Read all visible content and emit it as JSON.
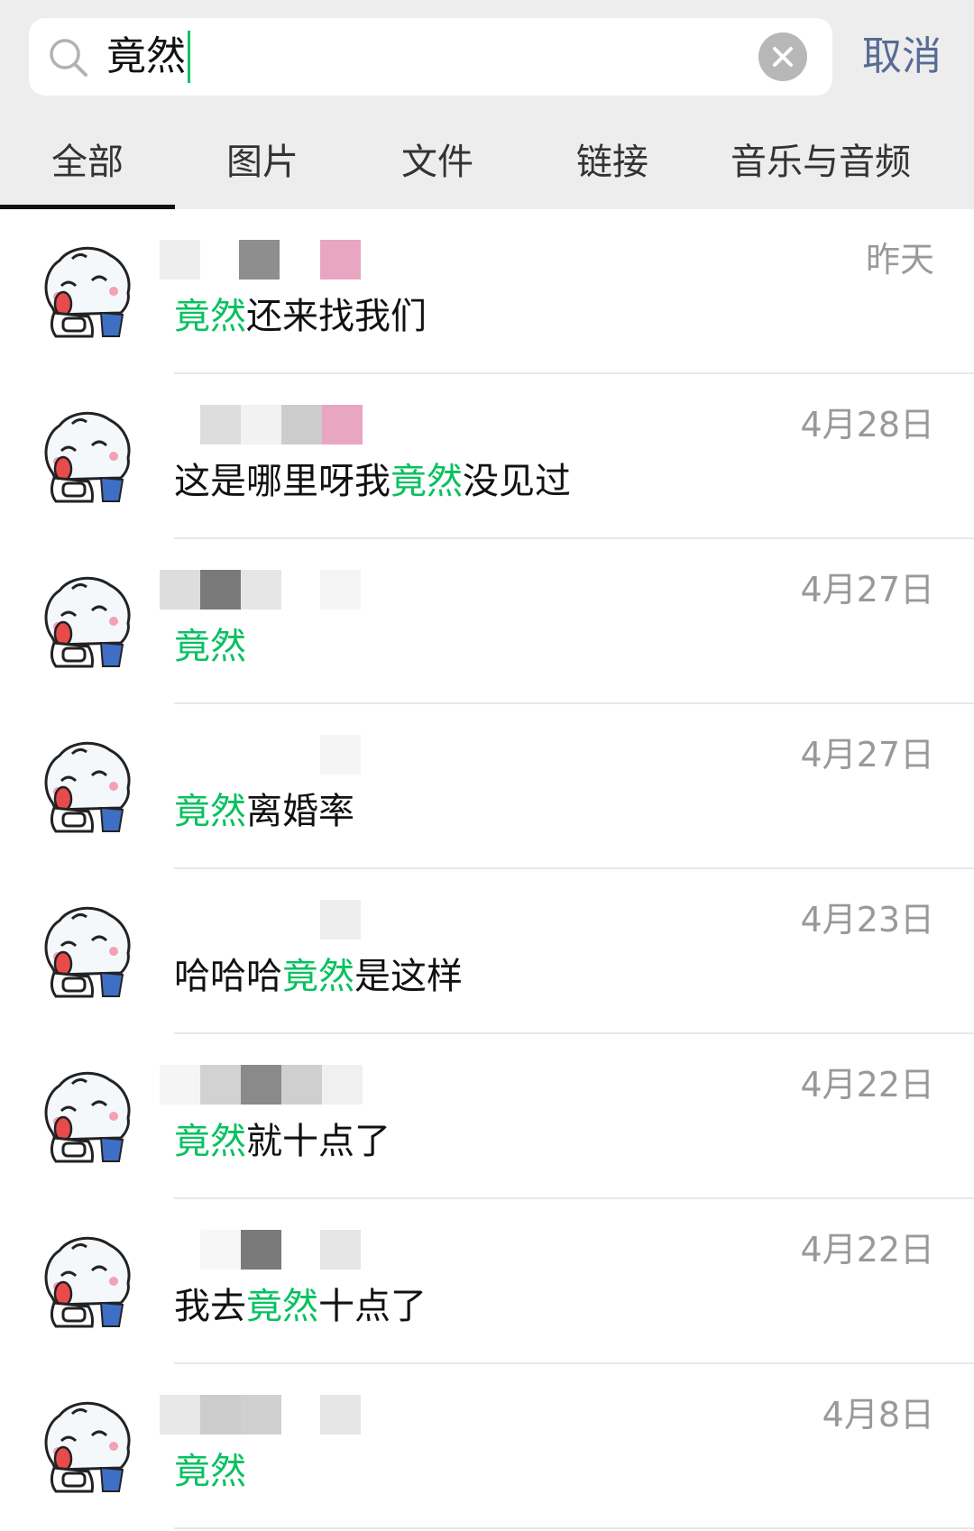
{
  "search": {
    "query": "竟然",
    "cancel_label": "取消"
  },
  "tabs": [
    {
      "label": "全部"
    },
    {
      "label": "图片"
    },
    {
      "label": "文件"
    },
    {
      "label": "链接"
    },
    {
      "label": "音乐与音频"
    }
  ],
  "results": [
    {
      "date": "昨天",
      "before": "",
      "keyword": "竟然",
      "after": "还来找我们"
    },
    {
      "date": "4月28日",
      "before": "这是哪里呀我",
      "keyword": "竟然",
      "after": "没见过"
    },
    {
      "date": "4月27日",
      "before": "",
      "keyword": "竟然",
      "after": ""
    },
    {
      "date": "4月27日",
      "before": "",
      "keyword": "竟然",
      "after": "离婚率"
    },
    {
      "date": "4月23日",
      "before": "哈哈哈",
      "keyword": "竟然",
      "after": "是这样"
    },
    {
      "date": "4月22日",
      "before": "",
      "keyword": "竟然",
      "after": "就十点了"
    },
    {
      "date": "4月22日",
      "before": "我去",
      "keyword": "竟然",
      "after": "十点了"
    },
    {
      "date": "4月8日",
      "before": "",
      "keyword": "竟然",
      "after": ""
    }
  ],
  "icons": {
    "search": "search-icon",
    "clear": "clear-icon",
    "avatar": "cartoon-dog-avatar"
  },
  "colors": {
    "highlight": "#07c160",
    "cancel": "#576b95",
    "background_bar": "#ededed",
    "date": "#999999"
  }
}
